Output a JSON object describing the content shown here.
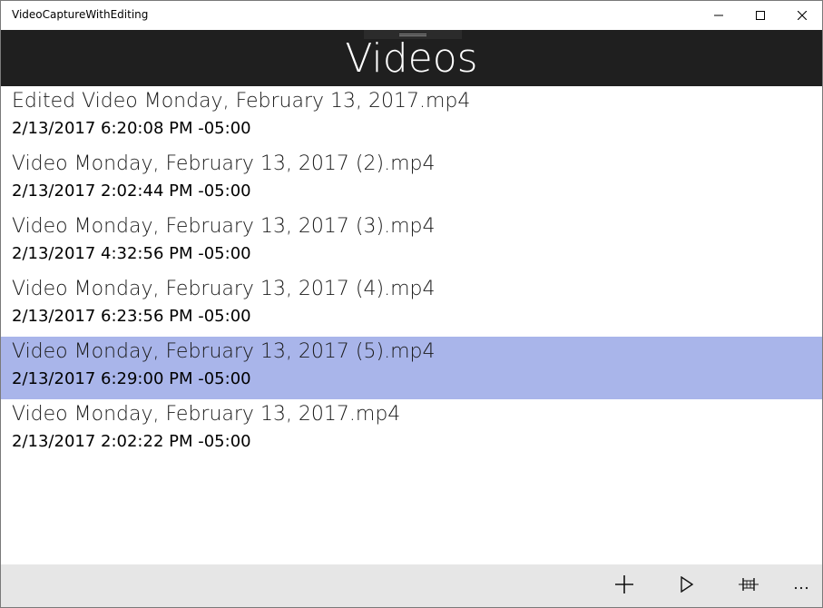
{
  "window": {
    "title": "VideoCaptureWithEditing",
    "controls": {
      "minimize_icon": "minimize-icon",
      "maximize_icon": "maximize-icon",
      "close_icon": "close-icon"
    }
  },
  "header": {
    "title": "Videos",
    "background": "#1f1f1f"
  },
  "videos": [
    {
      "name": "Edited Video Monday, February 13, 2017.mp4",
      "date": "2/13/2017 6:20:08 PM -05:00",
      "selected": false
    },
    {
      "name": "Video Monday, February 13, 2017 (2).mp4",
      "date": "2/13/2017 2:02:44 PM -05:00",
      "selected": false
    },
    {
      "name": "Video Monday, February 13, 2017 (3).mp4",
      "date": "2/13/2017 4:32:56 PM -05:00",
      "selected": false
    },
    {
      "name": "Video Monday, February 13, 2017 (4).mp4",
      "date": "2/13/2017 6:23:56 PM -05:00",
      "selected": false
    },
    {
      "name": "Video Monday, February 13, 2017 (5).mp4",
      "date": "2/13/2017 6:29:00 PM -05:00",
      "selected": true
    },
    {
      "name": "Video Monday, February 13, 2017.mp4",
      "date": "2/13/2017 2:02:22 PM -05:00",
      "selected": false
    }
  ],
  "selection_color": "#a9b5ea",
  "commandbar": {
    "buttons": [
      {
        "icon": "add-icon"
      },
      {
        "icon": "play-icon"
      },
      {
        "icon": "trim-icon"
      },
      {
        "icon": "more-icon",
        "label": "..."
      }
    ]
  }
}
